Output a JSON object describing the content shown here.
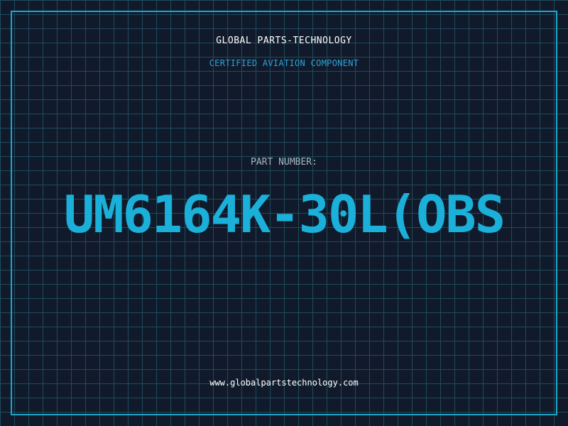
{
  "header": {
    "company": "GLOBAL PARTS-TECHNOLOGY",
    "tagline": "CERTIFIED AVIATION COMPONENT"
  },
  "part": {
    "label": "PART NUMBER:",
    "number": "UM6164K-30L(OBS"
  },
  "footer": {
    "website": "www.globalpartstechnology.com"
  },
  "colors": {
    "background": "#111a2b",
    "grid": "#1d4c5c",
    "accent": "#1bb0d9",
    "frame": "#1fa6c9"
  }
}
